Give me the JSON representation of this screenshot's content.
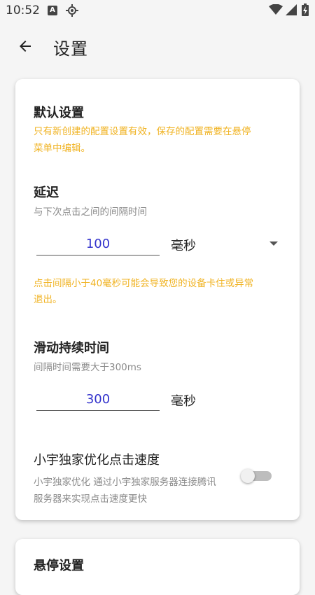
{
  "status_bar": {
    "time": "10:52",
    "notification_icon_letter": "A"
  },
  "app_bar": {
    "title": "设置"
  },
  "default_section": {
    "title": "默认设置",
    "note_line1": "只有新创建的配置设置有效，保存的配置需要在悬停",
    "note_line2": "菜单中编辑。"
  },
  "delay": {
    "title": "延迟",
    "subtitle": "与下次点击之间的间隔时间",
    "value": "100",
    "unit": "毫秒",
    "warning_line1": "点击间隔小于40毫秒可能会导致您的设备卡住或异常",
    "warning_line2": "退出。"
  },
  "swipe": {
    "title": "滑动持续时间",
    "subtitle": "间隔时间需要大于300ms",
    "value": "300",
    "unit": "毫秒"
  },
  "optimize": {
    "title": "小宇独家优化点击速度",
    "desc_line1": "小宇独家优化  通过小宇独家服务器连接腾讯",
    "desc_line2": "服务器来实现点击速度更快",
    "enabled": false
  },
  "next_card": {
    "title": "悬停设置"
  },
  "colors": {
    "warning": "#f0b323",
    "value_text": "#3333cc",
    "background": "#f5f5f5"
  }
}
